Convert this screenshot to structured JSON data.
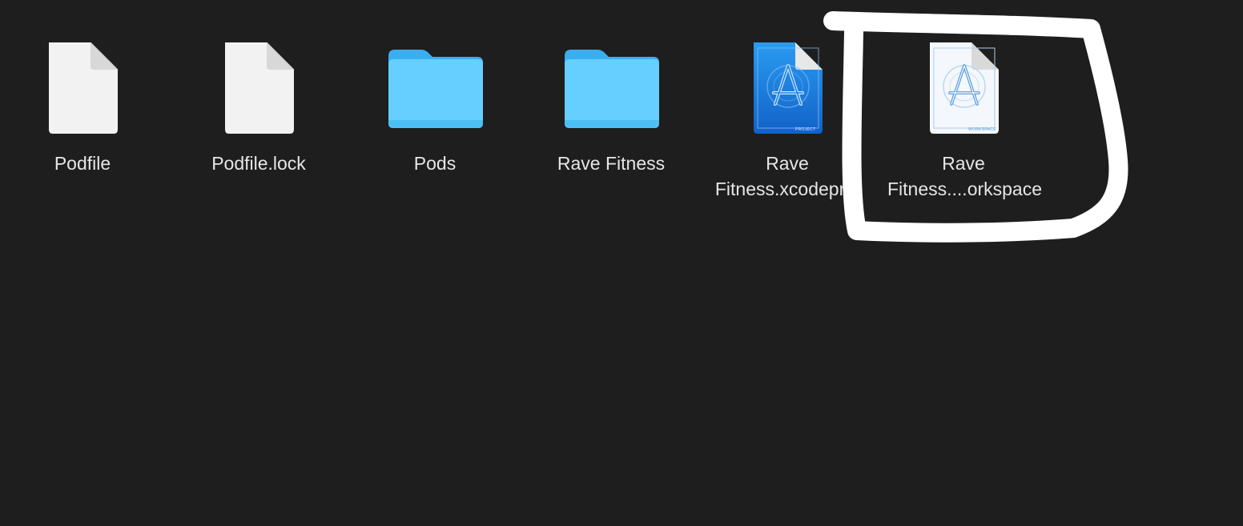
{
  "finder": {
    "items": [
      {
        "kind": "document",
        "icon": "document-icon",
        "label": "Podfile"
      },
      {
        "kind": "document",
        "icon": "document-icon",
        "label": "Podfile.lock"
      },
      {
        "kind": "folder",
        "icon": "folder-icon",
        "label": "Pods"
      },
      {
        "kind": "folder",
        "icon": "folder-icon",
        "label": "Rave Fitness"
      },
      {
        "kind": "xcodeproj",
        "icon": "xcode-project-icon",
        "label_line1": "Rave",
        "label_line2": "Fitness.xcodeproj",
        "badge": "PROJECT"
      },
      {
        "kind": "xcworkspace",
        "icon": "xcode-workspace-icon",
        "label_line1": "Rave",
        "label_line2": "Fitness....orkspace",
        "badge": "WORKSPACE"
      }
    ]
  },
  "colors": {
    "background": "#1e1e1e",
    "folder": "#66cfff",
    "folder_tab": "#3aaef0",
    "project_blue": "#1a7fe0",
    "annotation": "#ffffff"
  }
}
